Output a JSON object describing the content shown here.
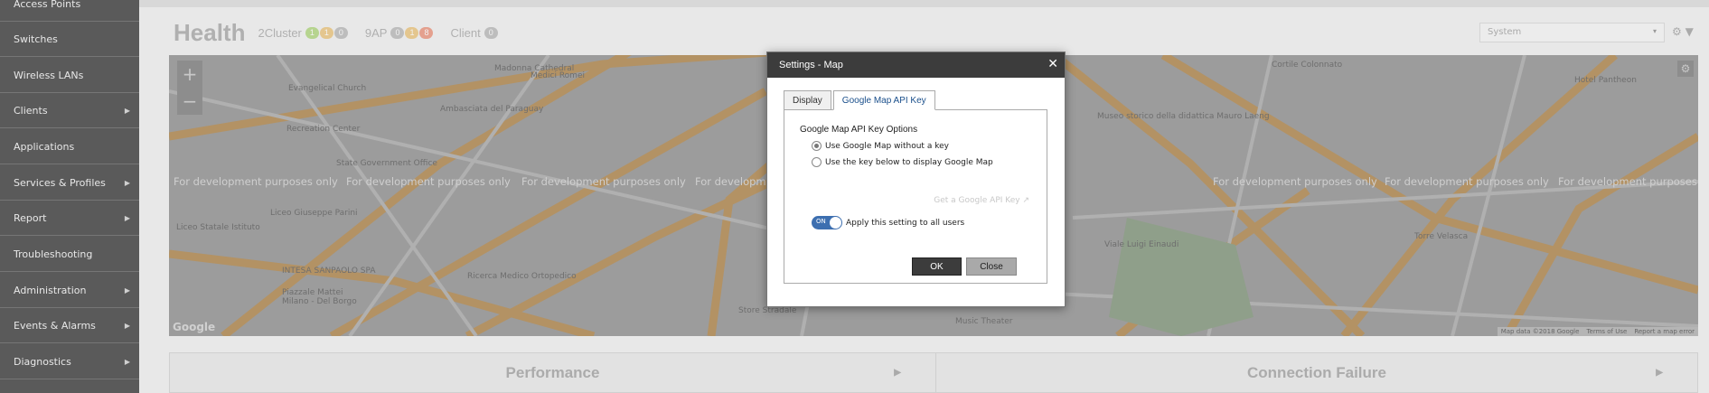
{
  "sidebar": {
    "items": [
      {
        "label": "Access Points",
        "has_arrow": false
      },
      {
        "label": "Switches",
        "has_arrow": false
      },
      {
        "label": "Wireless LANs",
        "has_arrow": false
      },
      {
        "label": "Clients",
        "has_arrow": true
      },
      {
        "label": "Applications",
        "has_arrow": false
      },
      {
        "label": "Services & Profiles",
        "has_arrow": true
      },
      {
        "label": "Report",
        "has_arrow": true
      },
      {
        "label": "Troubleshooting",
        "has_arrow": false
      },
      {
        "label": "Administration",
        "has_arrow": true
      },
      {
        "label": "Events & Alarms",
        "has_arrow": true
      },
      {
        "label": "Diagnostics",
        "has_arrow": true
      }
    ],
    "arrow_glyph": "▶"
  },
  "header": {
    "title": "Health",
    "cluster": {
      "label": "2Cluster",
      "badges": [
        "1",
        "1",
        "0"
      ]
    },
    "ap": {
      "label": "9AP",
      "badges": [
        "0",
        "1",
        "8"
      ]
    },
    "client": {
      "label": "Client",
      "badges": [
        "0"
      ]
    },
    "system_select": "System",
    "gear_glyph": "⚙",
    "filter_glyph": "▼",
    "caret_glyph": "▾"
  },
  "map": {
    "dev_text": "For development purposes only",
    "zoom_in": "+",
    "zoom_out": "−",
    "gear_glyph": "⚙",
    "google_logo": "Google",
    "labels": [
      "Ambasciata del Paraguay",
      "Evangelical Church",
      "Recreation Center",
      "State Government Office",
      "Liceo Giuseppe Parini",
      "Liceo Statale Istituto",
      "Ricerca Medico Ortopedico",
      "INTESA SANPAOLO SPA",
      "Piazzale Mattei",
      "Milano - Del Borgo",
      "Museo storico della didattica Mauro Laeng",
      "Cortile Colonnato",
      "Hotel Pantheon",
      "Viale Luigi Einaudi",
      "Medici Romei",
      "Music Theater",
      "Store Stradale",
      "Torre Velasca",
      "Madonna Cathedral"
    ],
    "footer": [
      "Map data ©2018 Google",
      "Terms of Use",
      "Report a map error"
    ]
  },
  "panels": {
    "performance": "Performance",
    "connection_failure": "Connection Failure",
    "tri_glyph": "▶"
  },
  "dialog": {
    "title": "Settings - Map",
    "close_glyph": "✕",
    "tabs": [
      {
        "label": "Display",
        "active": false
      },
      {
        "label": "Google Map API Key",
        "active": true
      }
    ],
    "options_title": "Google Map API Key Options",
    "radio_options": [
      {
        "label": "Use Google Map without a key",
        "checked": true
      },
      {
        "label": "Use the key below to display Google Map",
        "checked": false
      }
    ],
    "api_link": "Get a Google API Key",
    "toggle": {
      "state_label": "ON",
      "label": "Apply this setting to all users"
    },
    "ok_label": "OK",
    "close_label": "Close"
  }
}
